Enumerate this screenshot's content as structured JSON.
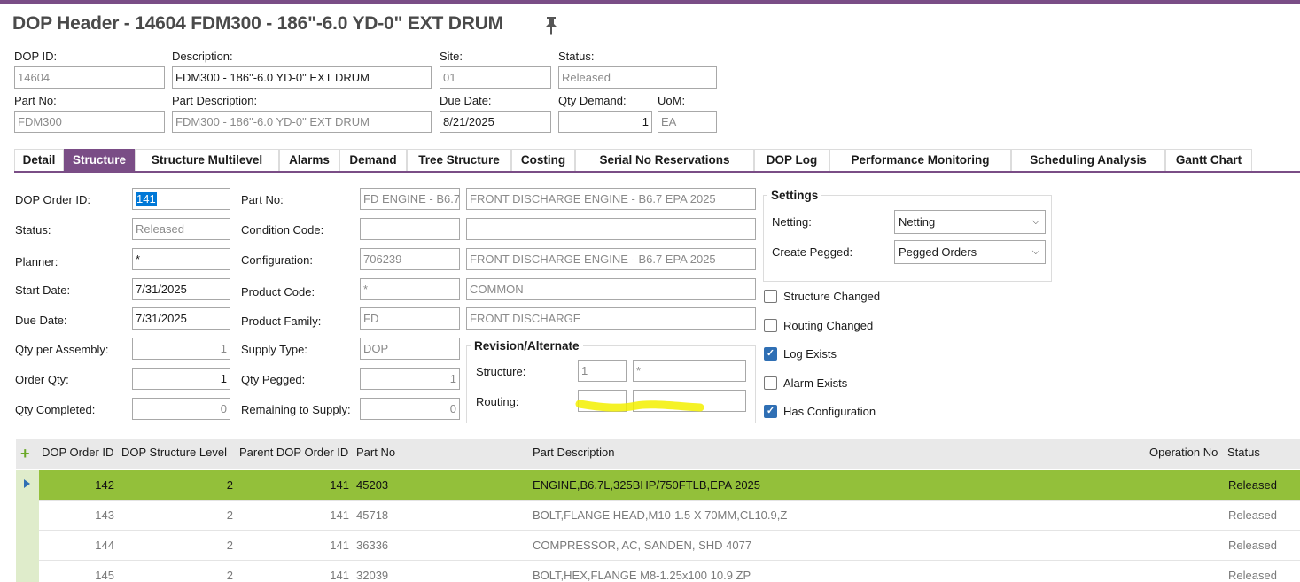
{
  "header": {
    "title": "DOP Header - 14604 FDM300 - 186\"-6.0 YD-0\" EXT DRUM",
    "pin_icon": "pin-icon",
    "fields": {
      "dop_id": {
        "label": "DOP ID:",
        "value": "14604"
      },
      "description": {
        "label": "Description:",
        "value": "FDM300 - 186\"-6.0 YD-0\" EXT DRUM"
      },
      "site": {
        "label": "Site:",
        "value": "01"
      },
      "status": {
        "label": "Status:",
        "value": "Released"
      },
      "part_no": {
        "label": "Part No:",
        "value": "FDM300"
      },
      "part_description": {
        "label": "Part Description:",
        "value": "FDM300 - 186\"-6.0 YD-0\" EXT DRUM"
      },
      "due_date": {
        "label": "Due Date:",
        "value": "8/21/2025"
      },
      "qty_demand": {
        "label": "Qty Demand:",
        "value": "1"
      },
      "uom": {
        "label": "UoM:",
        "value": "EA"
      }
    }
  },
  "tabs": [
    {
      "label": "Detail",
      "active": false
    },
    {
      "label": "Structure",
      "active": true
    },
    {
      "label": "Structure Multilevel",
      "active": false
    },
    {
      "label": "Alarms",
      "active": false
    },
    {
      "label": "Demand",
      "active": false
    },
    {
      "label": "Tree Structure",
      "active": false
    },
    {
      "label": "Costing",
      "active": false
    },
    {
      "label": "Serial No Reservations",
      "active": false
    },
    {
      "label": "DOP Log",
      "active": false
    },
    {
      "label": "Performance Monitoring",
      "active": false
    },
    {
      "label": "Scheduling Analysis",
      "active": false
    },
    {
      "label": "Gantt Chart",
      "active": false
    }
  ],
  "structure": {
    "left": {
      "dop_order_id": {
        "label": "DOP Order ID:",
        "value": "141"
      },
      "status": {
        "label": "Status:",
        "value": "Released"
      },
      "planner": {
        "label": "Planner:",
        "value": "*"
      },
      "start_date": {
        "label": "Start Date:",
        "value": "7/31/2025"
      },
      "due_date": {
        "label": "Due Date:",
        "value": "7/31/2025"
      },
      "qty_per_assembly": {
        "label": "Qty per Assembly:",
        "value": "1"
      },
      "order_qty": {
        "label": "Order Qty:",
        "value": "1"
      },
      "qty_completed": {
        "label": "Qty Completed:",
        "value": "0"
      }
    },
    "middle": {
      "part_no": {
        "label": "Part No:",
        "value": "FD ENGINE - B6.7",
        "desc": "FRONT DISCHARGE ENGINE - B6.7 EPA 2025"
      },
      "condition_code": {
        "label": "Condition Code:",
        "value": "",
        "desc": ""
      },
      "configuration": {
        "label": "Configuration:",
        "value": "706239",
        "desc": "FRONT DISCHARGE ENGINE - B6.7 EPA 2025"
      },
      "product_code": {
        "label": "Product Code:",
        "value": "*",
        "desc": "COMMON"
      },
      "product_family": {
        "label": "Product Family:",
        "value": "FD",
        "desc": "FRONT DISCHARGE"
      },
      "supply_type": {
        "label": "Supply Type:",
        "value": "DOP"
      },
      "qty_pegged": {
        "label": "Qty Pegged:",
        "value": "1"
      },
      "remaining_to_supply": {
        "label": "Remaining to Supply:",
        "value": "0"
      }
    },
    "revision": {
      "title": "Revision/Alternate",
      "structure": {
        "label": "Structure:",
        "revision": "1",
        "alternate": "*"
      },
      "routing": {
        "label": "Routing:",
        "revision": "",
        "alternate": ""
      }
    },
    "settings": {
      "title": "Settings",
      "netting": {
        "label": "Netting:",
        "value": "Netting"
      },
      "create_pegged": {
        "label": "Create Pegged:",
        "value": "Pegged Orders"
      }
    },
    "checkboxes": [
      {
        "label": "Structure Changed",
        "checked": false
      },
      {
        "label": "Routing Changed",
        "checked": false
      },
      {
        "label": "Log Exists",
        "checked": true
      },
      {
        "label": "Alarm Exists",
        "checked": false
      },
      {
        "label": "Has Configuration",
        "checked": true
      }
    ]
  },
  "grid": {
    "columns": [
      "DOP Order ID",
      "DOP Structure Level",
      "Parent DOP Order ID",
      "Part No",
      "Part Description",
      "Operation No",
      "Status"
    ],
    "rows": [
      {
        "dop_order_id": "142",
        "level": "2",
        "parent": "141",
        "part_no": "45203",
        "part_description": "ENGINE,B6.7L,325BHP/750FTLB,EPA 2025",
        "operation_no": "",
        "status": "Released"
      },
      {
        "dop_order_id": "143",
        "level": "2",
        "parent": "141",
        "part_no": "45718",
        "part_description": "BOLT,FLANGE HEAD,M10-1.5 X 70MM,CL10.9,Z",
        "operation_no": "",
        "status": "Released"
      },
      {
        "dop_order_id": "144",
        "level": "2",
        "parent": "141",
        "part_no": "36336",
        "part_description": "COMPRESSOR, AC, SANDEN, SHD 4077",
        "operation_no": "",
        "status": "Released"
      },
      {
        "dop_order_id": "145",
        "level": "2",
        "parent": "141",
        "part_no": "32039",
        "part_description": "BOLT,HEX,FLANGE M8-1.25x100 10.9 ZP",
        "operation_no": "",
        "status": "Released"
      }
    ]
  },
  "colors": {
    "accent": "#7a4d86",
    "selected_row": "#93c03a",
    "checkbox": "#2f6fb4",
    "highlight": "#f3f000"
  }
}
